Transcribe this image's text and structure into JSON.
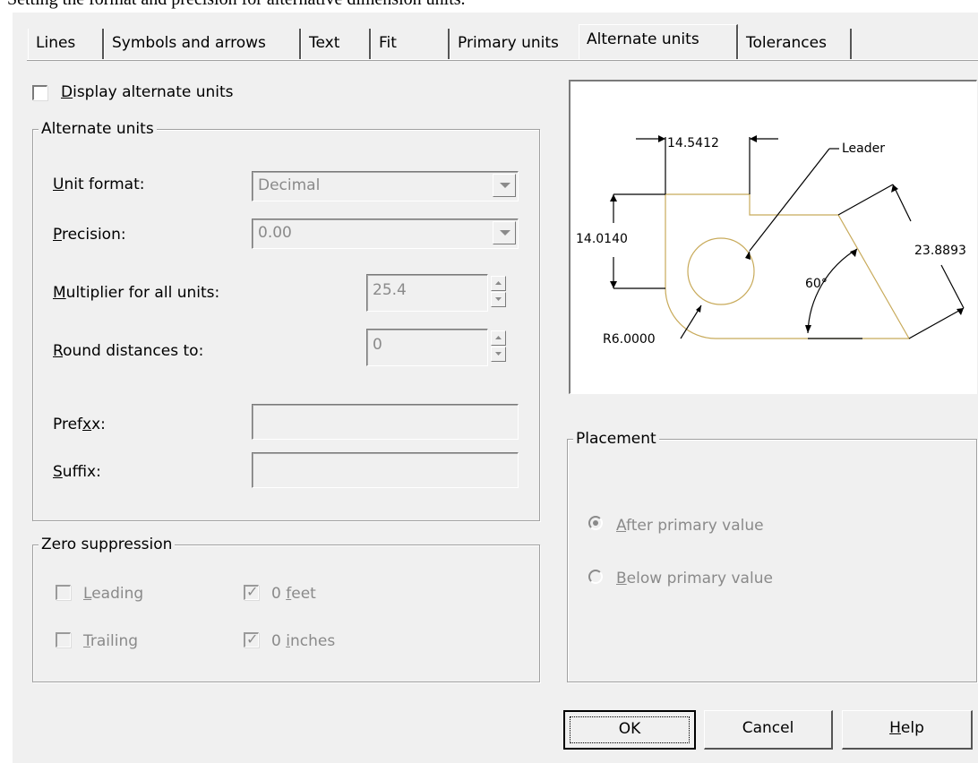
{
  "caption": "Setting the format and precision for alternative dimension units.",
  "tabs": [
    {
      "label": "Lines"
    },
    {
      "label": "Symbols and arrows"
    },
    {
      "label": "Text"
    },
    {
      "label": "Fit"
    },
    {
      "label": "Primary units"
    },
    {
      "label": "Alternate units",
      "active": true
    },
    {
      "label": "Tolerances"
    }
  ],
  "display_alternate": {
    "label": "Display alternate units",
    "accel": "D",
    "checked": false
  },
  "alternate_units": {
    "title": "Alternate units",
    "unit_format": {
      "label": "Unit format:",
      "accel": "U",
      "value": "Decimal"
    },
    "precision": {
      "label": "Precision:",
      "accel": "P",
      "value": "0.00"
    },
    "multiplier": {
      "label": "Multiplier for all units:",
      "accel": "M",
      "value": "25.4"
    },
    "round": {
      "label": "Round distances to:",
      "accel": "R",
      "value": "0"
    },
    "prefix": {
      "label": "Prefix:",
      "accel": "x",
      "value": ""
    },
    "suffix": {
      "label": "Suffix:",
      "accel": "S",
      "value": ""
    }
  },
  "zero_suppression": {
    "title": "Zero suppression",
    "leading": {
      "label": "Leading",
      "checked": false
    },
    "trailing": {
      "label": "Trailing",
      "checked": false
    },
    "zero_feet": {
      "label": "0 feet",
      "checked": true
    },
    "zero_inches": {
      "label": "0 inches",
      "checked": true
    }
  },
  "preview": {
    "dim_top": "14.5412",
    "dim_left": "14.0140",
    "dim_right": "23.8893",
    "angle": "60°",
    "radius": "R6.0000",
    "leader": "Leader"
  },
  "placement": {
    "title": "Placement",
    "after": {
      "label": "After primary value",
      "selected": true
    },
    "below": {
      "label": "Below primary value",
      "selected": false
    }
  },
  "buttons": {
    "ok": "OK",
    "cancel": "Cancel",
    "help": "Help"
  }
}
